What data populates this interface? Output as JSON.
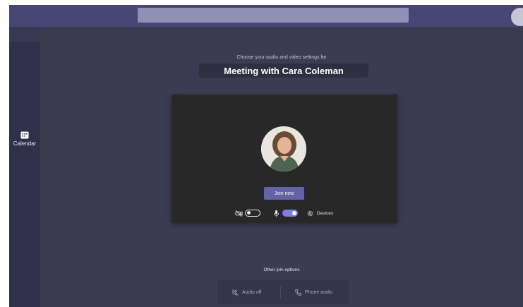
{
  "rail": {
    "items": [
      {
        "label": "Calendar",
        "icon": "calendar-icon"
      }
    ]
  },
  "prejoin": {
    "subtitle": "Choose your audio and video settings for",
    "title": "Meeting with Cara Coleman",
    "join_label": "Join now",
    "devices_label": "Devices",
    "camera_on": false,
    "mic_on": true
  },
  "other_options": {
    "label": "Other join options",
    "audio_off_label": "Audio off",
    "phone_audio_label": "Phone audio"
  },
  "colors": {
    "accent": "#6264a7",
    "toggle_on": "#7b7fe6",
    "topbar": "#464775"
  }
}
